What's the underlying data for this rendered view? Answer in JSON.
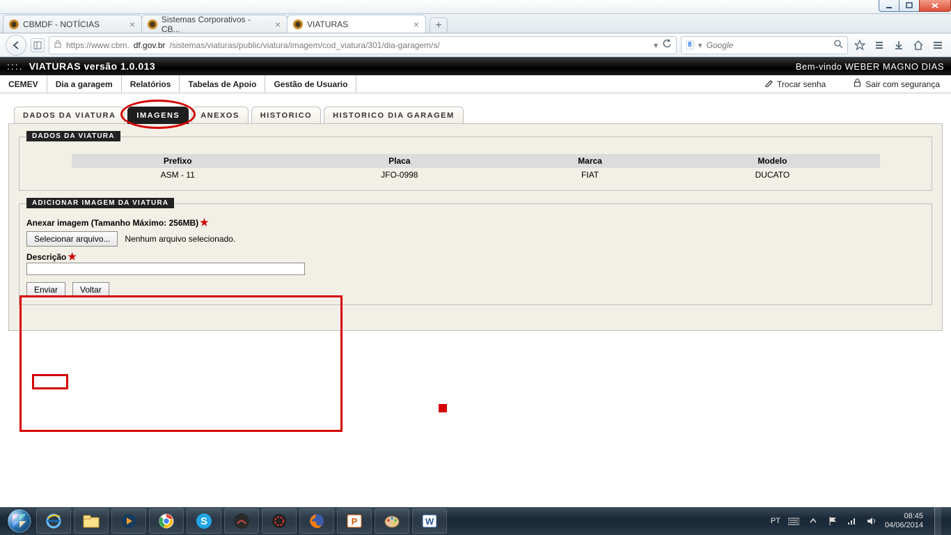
{
  "window": {
    "minimize": "_",
    "maximize": "❐",
    "close": "×"
  },
  "browser": {
    "tabs": [
      {
        "label": "CBMDF - NOTÍCIAS"
      },
      {
        "label": "Sistemas Corporativos - CB..."
      },
      {
        "label": "VIATURAS"
      }
    ],
    "newtab": "+",
    "url_prefix": "https://www.cbm.",
    "url_host": "df.gov.br",
    "url_path": "/sistemas/viaturas/public/viatura/imagem/cod_viatura/301/dia-garagem/s/",
    "search_engine": "8",
    "search_placeholder": "Google",
    "icons": {
      "back": "←",
      "sidebar": "▥",
      "lock": "🔒",
      "dropdown": "▾",
      "reload": "↻",
      "star": "☆",
      "list": "≣",
      "download": "⬇",
      "home": "⌂",
      "menu": "≡",
      "search": "🔍"
    }
  },
  "app": {
    "dots": ":::.",
    "title": "VIATURAS versão 1.0.013",
    "welcome": "Bem-vindo WEBER MAGNO DIAS",
    "menu": [
      "CEMEV",
      "Dia a garagem",
      "Relatórios",
      "Tabelas de Apoio",
      "Gestão de Usuario"
    ],
    "actions": {
      "change_pw_icon": "✎",
      "change_pw": "Trocar senha",
      "logout_icon": "🔒",
      "logout": "Sair com segurança"
    }
  },
  "subtabs": [
    "DADOS DA VIATURA",
    "IMAGENS",
    "ANEXOS",
    "HISTORICO",
    "HISTORICO DIA GARAGEM"
  ],
  "vehicle": {
    "legend": "DADOS DA VIATURA",
    "headers": [
      "Prefixo",
      "Placa",
      "Marca",
      "Modelo"
    ],
    "row": [
      "ASM - 11",
      "JFO-0998",
      "FIAT",
      "DUCATO"
    ]
  },
  "form": {
    "legend": "ADICIONAR IMAGEM DA VIATURA",
    "attach_label": "Anexar imagem (Tamanho Máximo: 256MB)",
    "choose_file": "Selecionar arquivo...",
    "no_file": "Nenhum arquivo selecionado.",
    "desc_label": "Descrição",
    "submit": "Enviar",
    "back": "Voltar"
  },
  "taskbar": {
    "lang": "PT",
    "time": "08:45",
    "date": "04/06/2014"
  }
}
